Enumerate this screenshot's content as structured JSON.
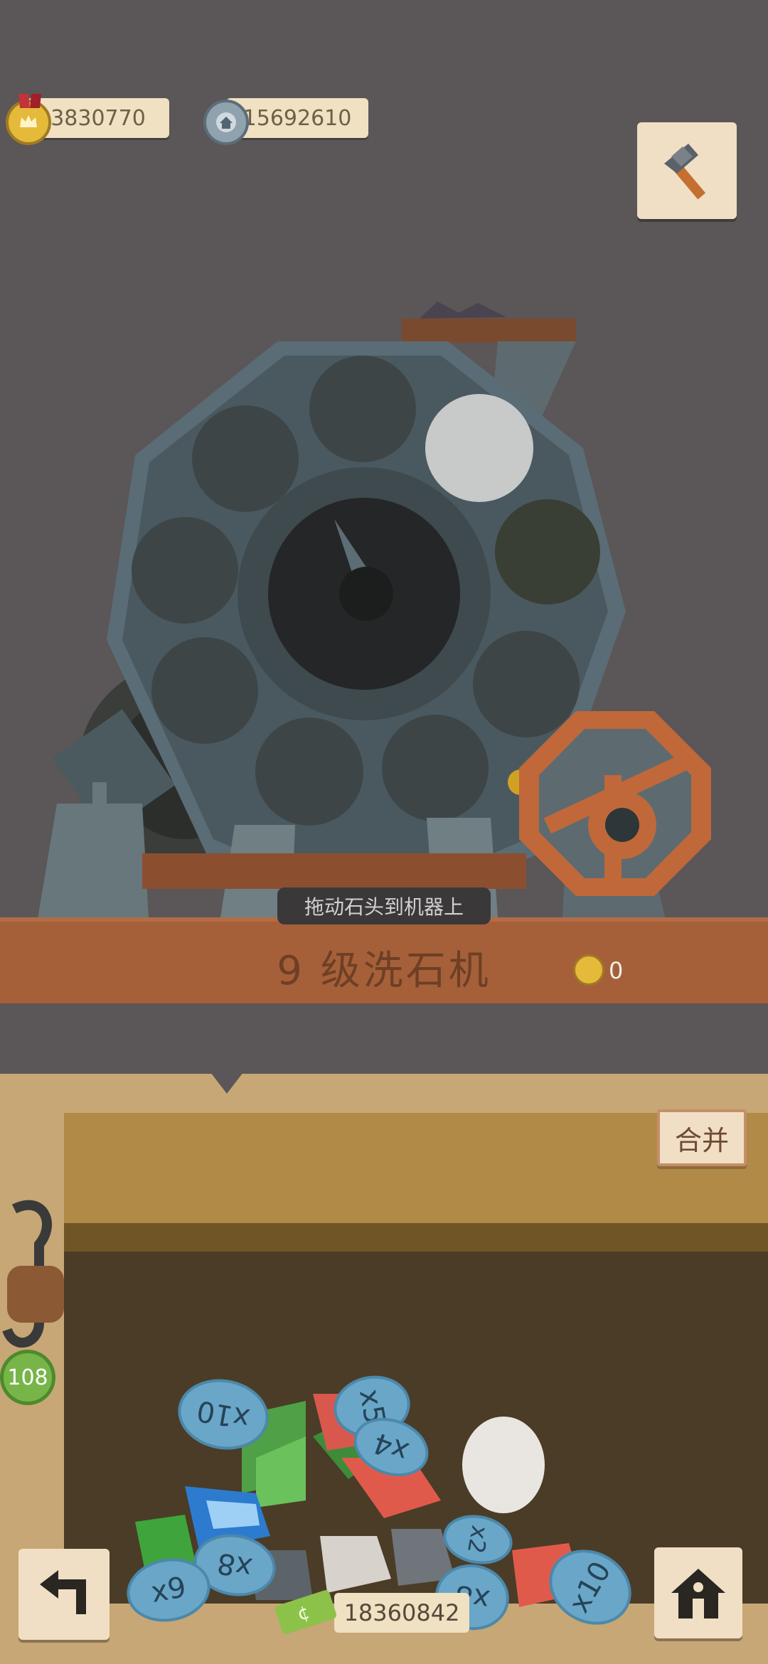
{
  "header": {
    "medal_currency": "3830770",
    "gear_currency": "15692610"
  },
  "machine": {
    "hint": "拖动石头到机器上",
    "title": "9 级洗石机",
    "reward": "0"
  },
  "bag": {
    "merge_label": "合并",
    "money": "18360842",
    "side_badge": "108",
    "multipliers": [
      "x10",
      "x5",
      "x4",
      "x2",
      "x8",
      "x9",
      "x8",
      "x10"
    ]
  },
  "icons": {
    "top_right": "hammer-icon",
    "bottom_left": "back-arrow-icon",
    "bottom_right": "home-icon"
  },
  "colors": {
    "background": "#5b5657",
    "wood": "#a5603a",
    "bag": "#c7a775",
    "chip": "#efe1c2"
  }
}
